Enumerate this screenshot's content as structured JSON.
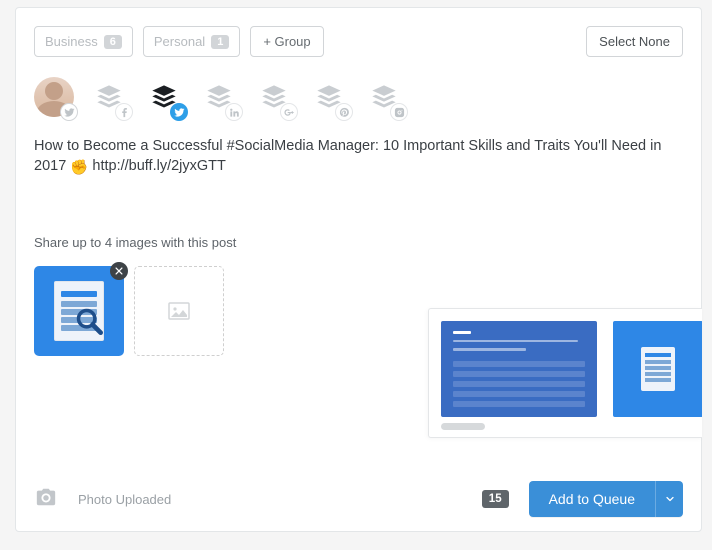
{
  "groups": {
    "business": {
      "label": "Business",
      "count": "6"
    },
    "personal": {
      "label": "Personal",
      "count": "1"
    },
    "add_label": "+ Group"
  },
  "select_none_label": "Select None",
  "compose": {
    "text_before": "How to Become a Successful #SocialMedia Manager: 10 Important Skills and Traits You'll Need in 2017 ",
    "text_after": " http://buff.ly/2jyxGTT"
  },
  "share_hint": "Share up to 4 images with this post",
  "photo_uploaded_label": "Photo Uploaded",
  "count_badge": "15",
  "add_to_queue_label": "Add to Queue"
}
